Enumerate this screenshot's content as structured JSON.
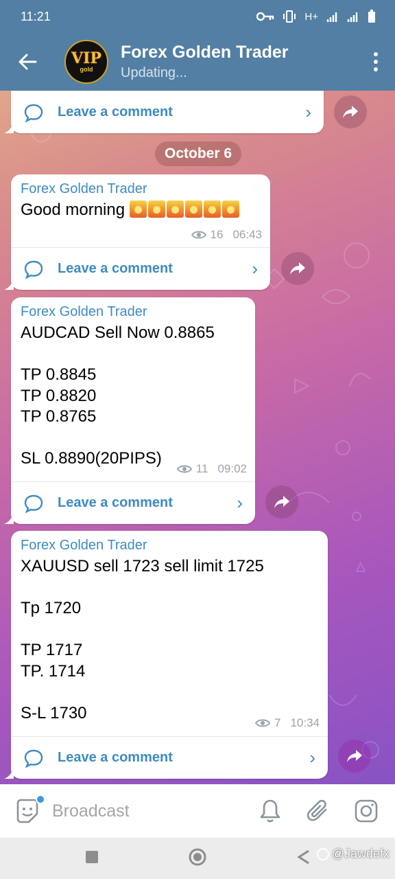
{
  "status_bar": {
    "time": "11:21",
    "network": "H+"
  },
  "header": {
    "title": "Forex Golden Trader",
    "subtitle": "Updating...",
    "avatar": {
      "brand": "VIP",
      "tagline": "gold"
    }
  },
  "chat": {
    "date_separator": "October 6",
    "leave_comment_label": "Leave a comment",
    "messages": [
      {
        "sender": "Forex Golden Trader",
        "text": "Good morning",
        "emoji_count": 6,
        "views": "16",
        "time": "06:43"
      },
      {
        "sender": "Forex Golden Trader",
        "text": "AUDCAD Sell Now  0.8865\n\nTP 0.8845\nTP 0.8820\nTP 0.8765\n\nSL 0.8890(20PIPS)",
        "views": "11",
        "time": "09:02"
      },
      {
        "sender": "Forex Golden Trader",
        "text": "XAUUSD   sell   1723   sell  limit 1725\n\nTp 1720\n\nTP 1717\nTP. 1714\n\nS-L 1730",
        "views": "7",
        "time": "10:34"
      }
    ]
  },
  "input_bar": {
    "placeholder": "Broadcast"
  },
  "watermark": {
    "text": "@Jawdefx"
  },
  "colors": {
    "header": "#527fa3",
    "link": "#3d8bc2",
    "meta": "#9aa3ab"
  }
}
